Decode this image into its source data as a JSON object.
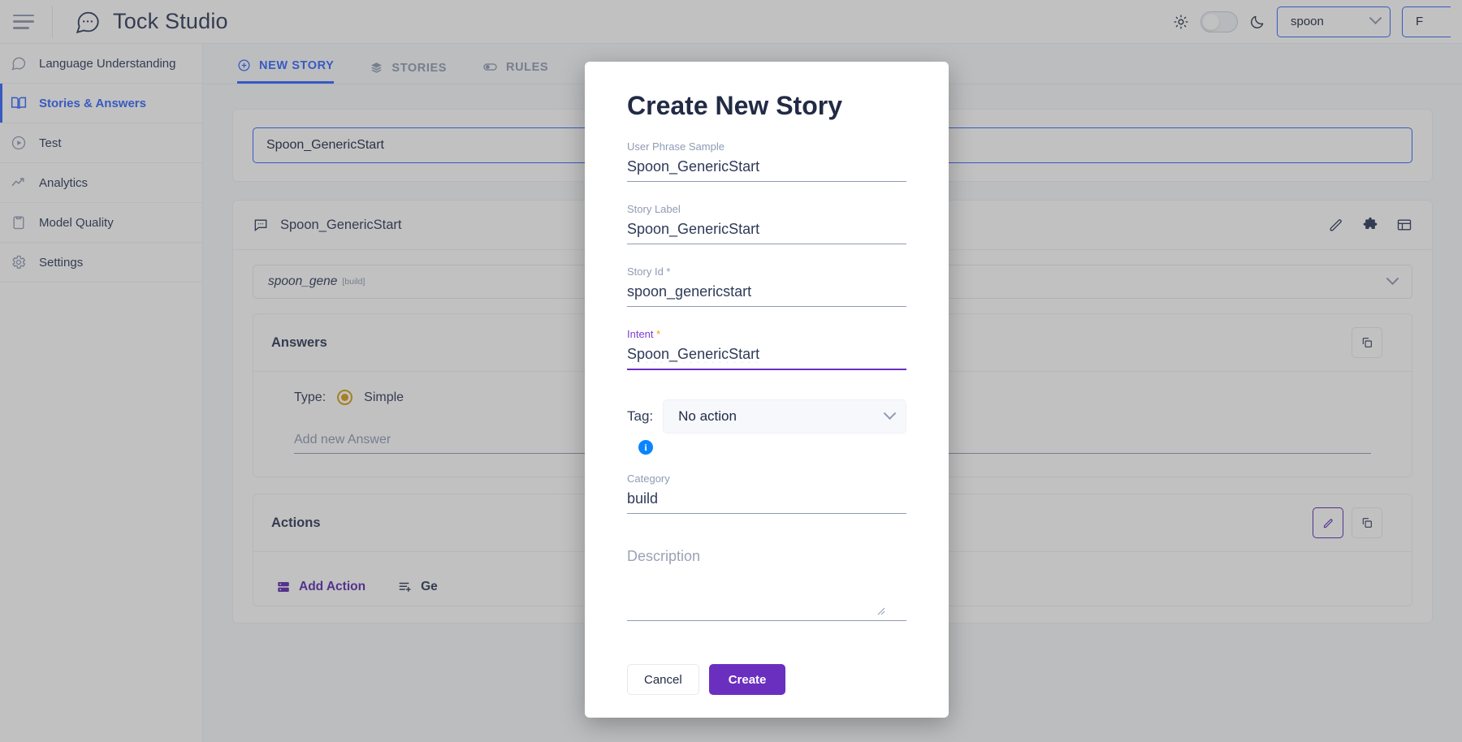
{
  "topbar": {
    "menu_icon": "hamburger-menu-icon",
    "logo_icon": "chat-bubble-icon",
    "title": "Tock Studio",
    "light_icon": "sun-icon",
    "dark_icon": "moon-icon",
    "namespace_select": "spoon",
    "second_select": "F"
  },
  "sidebar": {
    "items": [
      {
        "label": "Language Understanding",
        "icon": "chat-bubble-icon",
        "active": false
      },
      {
        "label": "Stories & Answers",
        "icon": "book-icon",
        "active": true
      },
      {
        "label": "Test",
        "icon": "play-circle-icon",
        "active": false
      },
      {
        "label": "Analytics",
        "icon": "trending-up-icon",
        "active": false
      },
      {
        "label": "Model Quality",
        "icon": "clipboard-icon",
        "active": false
      },
      {
        "label": "Settings",
        "icon": "gear-icon",
        "active": false
      }
    ]
  },
  "tabs": [
    {
      "label": "NEW STORY",
      "icon": "plus-circle-icon",
      "active": true
    },
    {
      "label": "STORIES",
      "icon": "layers-icon",
      "active": false
    },
    {
      "label": "RULES",
      "icon": "toggle-icon",
      "active": false
    }
  ],
  "background": {
    "search_value": "Spoon_GenericStart",
    "story_title": "Spoon_GenericStart",
    "story_icon": "message-square-icon",
    "chip_text": "spoon_gene",
    "chip_sup": "[build]",
    "answers": {
      "panel_title": "Answers",
      "type_label": "Type:",
      "type_value": "Simple",
      "add_answer_placeholder": "Add new Answer"
    },
    "actions": {
      "panel_title": "Actions",
      "add_action_label": "Add Action",
      "generate_label": "Ge"
    },
    "tools": {
      "edit_icon": "pencil-icon",
      "puzzle_icon": "puzzle-icon",
      "board_icon": "board-icon",
      "copy_icon": "copy-icon"
    }
  },
  "modal": {
    "title": "Create New Story",
    "fields": {
      "user_phrase_sample": {
        "label": "User Phrase Sample",
        "value": "Spoon_GenericStart"
      },
      "story_label": {
        "label": "Story Label",
        "value": "Spoon_GenericStart"
      },
      "story_id": {
        "label": "Story Id *",
        "value": "spoon_genericstart"
      },
      "intent": {
        "label": "Intent",
        "required": "*",
        "value": "Spoon_GenericStart"
      },
      "tag": {
        "label": "Tag:",
        "value": "No action",
        "info_icon": "info-icon",
        "info_text": "i"
      },
      "category": {
        "label": "Category",
        "value": "build"
      },
      "description": {
        "label": "Description",
        "value": "",
        "placeholder": "Description"
      }
    },
    "buttons": {
      "cancel": "Cancel",
      "create": "Create"
    }
  },
  "colors": {
    "accent_blue": "#3366ff",
    "accent_purple": "#6b2fc0",
    "focus_purple": "#7b3fd0",
    "required_amber": "#f0a202",
    "info_blue": "#0a84ff",
    "radio_gold": "#d4a017"
  }
}
